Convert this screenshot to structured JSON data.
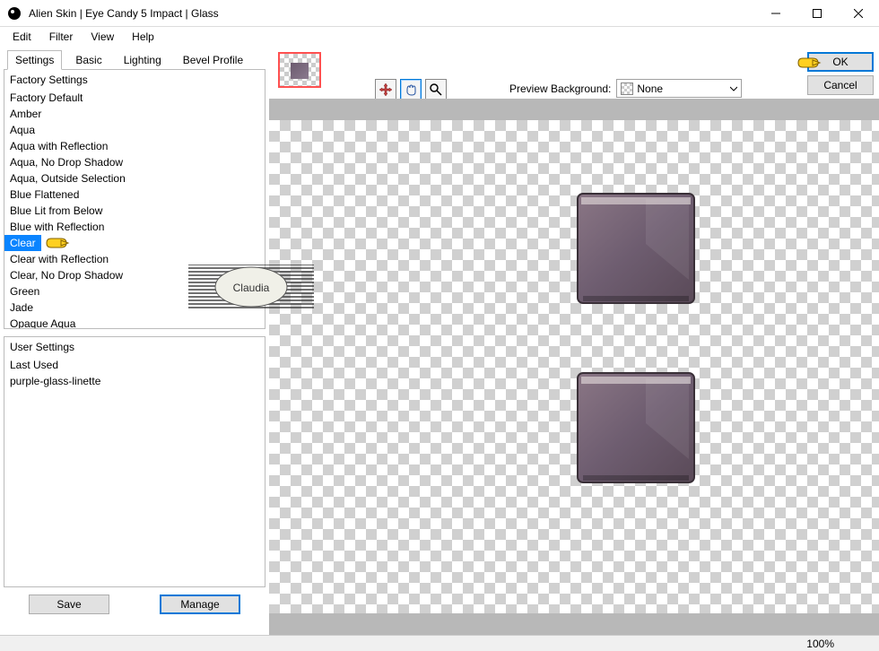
{
  "window": {
    "title": "Alien Skin | Eye Candy 5 Impact | Glass"
  },
  "menu": {
    "edit": "Edit",
    "filter": "Filter",
    "view": "View",
    "help": "Help"
  },
  "tabs": {
    "settings": "Settings",
    "basic": "Basic",
    "lighting": "Lighting",
    "bevel": "Bevel Profile"
  },
  "factory": {
    "header": "Factory Settings",
    "items": [
      "Factory Default",
      "Amber",
      "Aqua",
      "Aqua with Reflection",
      "Aqua, No Drop Shadow",
      "Aqua, Outside Selection",
      "Blue Flattened",
      "Blue Lit from Below",
      "Blue with Reflection",
      "Clear",
      "Clear with Reflection",
      "Clear, No Drop Shadow",
      "Green",
      "Jade",
      "Opaque Aqua"
    ],
    "selected": "Clear"
  },
  "user": {
    "header": "User Settings",
    "items": [
      "Last Used",
      "purple-glass-linette"
    ]
  },
  "buttons": {
    "save": "Save",
    "manage": "Manage",
    "ok": "OK",
    "cancel": "Cancel"
  },
  "preview": {
    "label": "Preview Background:",
    "value": "None"
  },
  "status": {
    "zoom": "100%"
  },
  "watermark": {
    "text": "Claudia"
  }
}
